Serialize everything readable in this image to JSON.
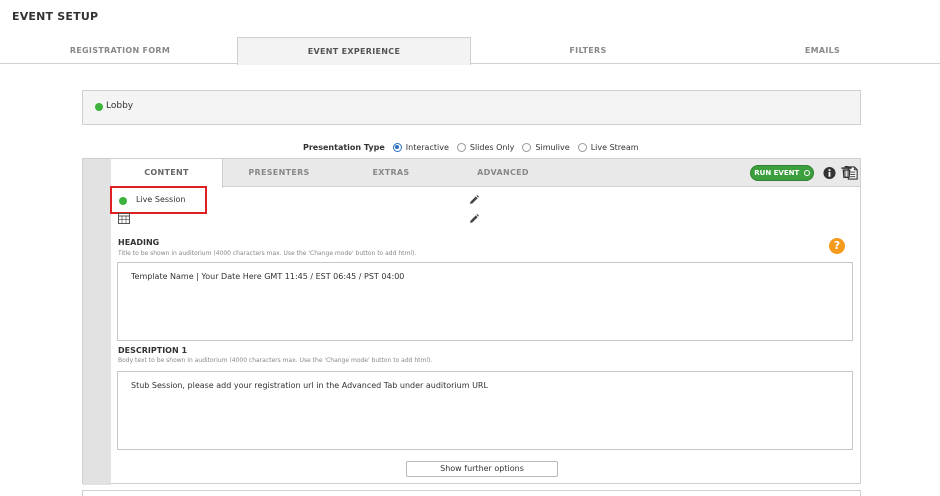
{
  "page": {
    "title": "EVENT SETUP"
  },
  "main_tabs": [
    {
      "label": "REGISTRATION FORM",
      "active": false
    },
    {
      "label": "EVENT EXPERIENCE",
      "active": true
    },
    {
      "label": "FILTERS",
      "active": false
    },
    {
      "label": "EMAILS",
      "active": false
    }
  ],
  "lobby": {
    "label": "Lobby",
    "status_color": "#3db33d"
  },
  "presentation_type": {
    "label": "Presentation Type",
    "options": [
      {
        "label": "Interactive",
        "selected": true
      },
      {
        "label": "Slides Only",
        "selected": false
      },
      {
        "label": "Simulive",
        "selected": false
      },
      {
        "label": "Live Stream",
        "selected": false
      }
    ]
  },
  "session": {
    "tabs": [
      {
        "label": "CONTENT",
        "active": true
      },
      {
        "label": "PRESENTERS",
        "active": false
      },
      {
        "label": "EXTRAS",
        "active": false
      },
      {
        "label": "ADVANCED",
        "active": false
      }
    ],
    "run_event_label": "RUN EVENT",
    "status_label": "Live Session",
    "status_color": "#3db33d",
    "toolbar_icons": [
      "info-icon",
      "document-icon",
      "trash-icon"
    ],
    "heading": {
      "label": "HEADING",
      "hint": "Title to be shown in auditorium (4000 characters max. Use the 'Change mode' button to add html).",
      "value": "Template Name | Your Date Here GMT 11:45 / EST 06:45 / PST 04:00"
    },
    "description": {
      "label": "DESCRIPTION 1",
      "hint": "Body text to be shown in auditorium (4000 characters max. Use the 'Change mode' button to add html).",
      "value": "Stub Session, please add your registration url in the Advanced Tab under auditorium URL"
    },
    "further_options_label": "Show further options"
  },
  "colors": {
    "accent_green": "#3c9e3c",
    "highlight_red": "#e02020",
    "help_orange": "#f59a1c",
    "radio_blue": "#2a6fbf"
  }
}
